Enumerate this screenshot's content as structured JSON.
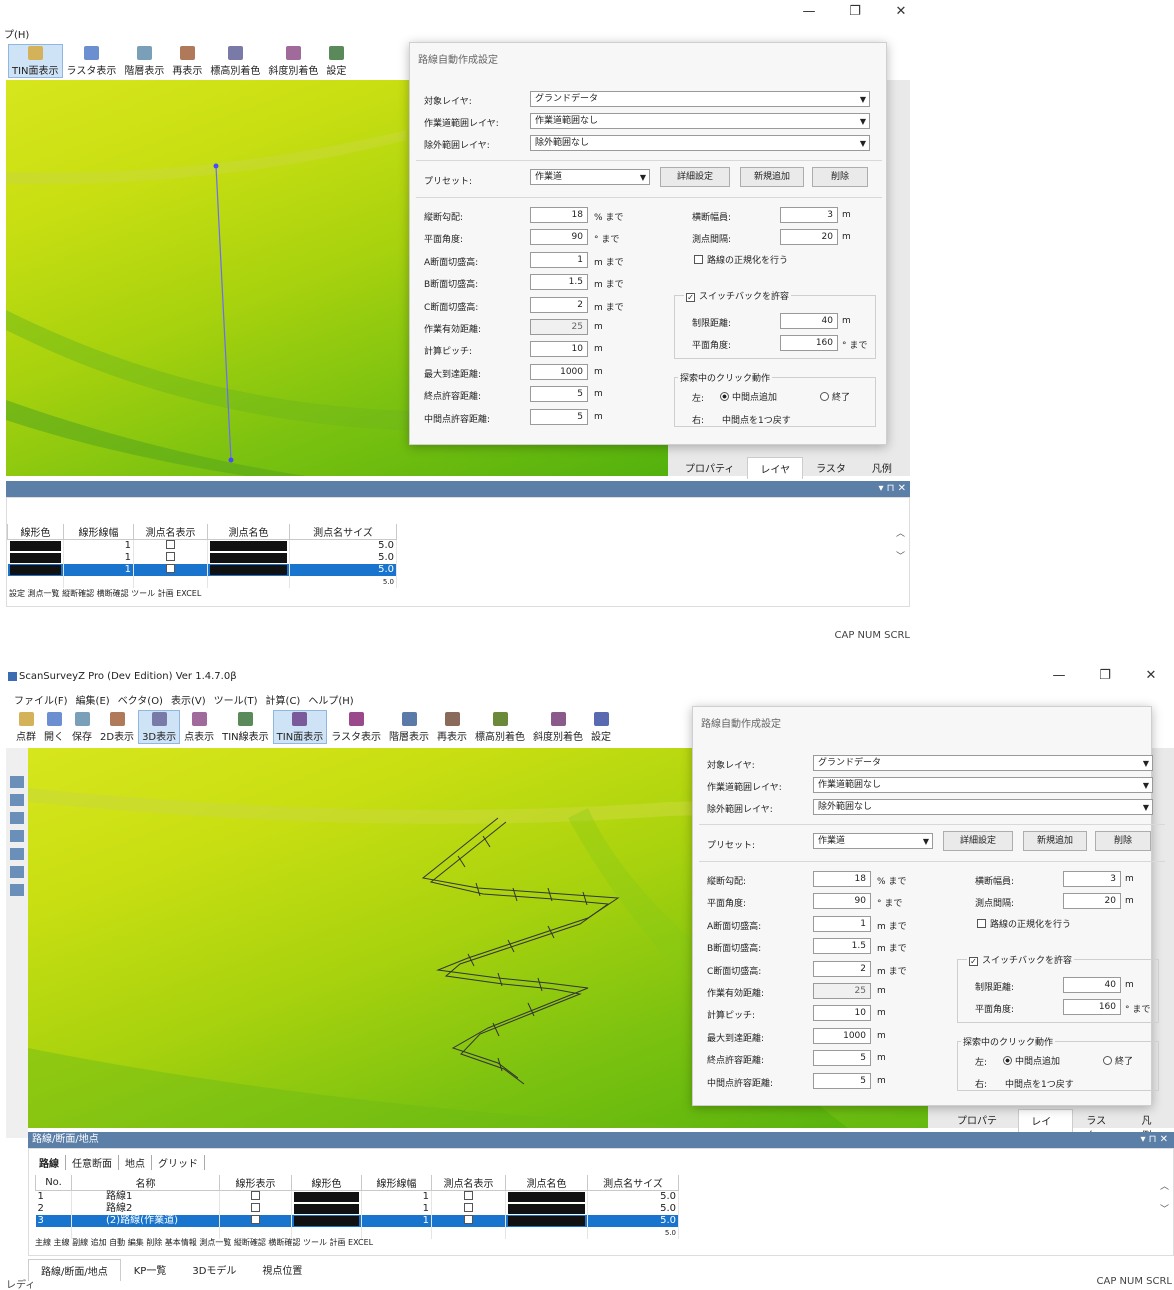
{
  "top": {
    "menu_help": "プ(H)",
    "toolbar": [
      {
        "label": "TIN面表示",
        "active": true
      },
      {
        "label": "ラスタ表示"
      },
      {
        "label": "階層表示"
      },
      {
        "label": "再表示"
      },
      {
        "label": "標高別着色"
      },
      {
        "label": "斜度別着色"
      },
      {
        "label": "設定"
      }
    ],
    "grid_headers": [
      "線形色",
      "線形線幅",
      "測点名表示",
      "測点名色",
      "測点名サイズ"
    ],
    "grid_rows": [
      {
        "width": "1",
        "size": "5.0",
        "selected": false
      },
      {
        "width": "1",
        "size": "5.0",
        "selected": false
      },
      {
        "width": "1",
        "size": "5.0",
        "selected": true
      }
    ],
    "grid_partial": "5.0",
    "bottom_tools": "設定  測点一覧  縦断確認  横断確認  ツール  計画  EXCEL",
    "dock_tabs": [
      "プロパティ",
      "レイヤ",
      "ラスタ",
      "凡例"
    ],
    "status": "CAP NUM SCRL"
  },
  "app": {
    "title": "ScanSurveyZ Pro  (Dev Edition)  Ver 1.4.7.0β",
    "menu": [
      "ファイル(F)",
      "編集(E)",
      "ベクタ(O)",
      "表示(V)",
      "ツール(T)",
      "計算(C)",
      "ヘルプ(H)"
    ],
    "toolbar": [
      {
        "label": "点群"
      },
      {
        "label": "開く"
      },
      {
        "label": "保存"
      },
      {
        "label": "2D表示"
      },
      {
        "label": "3D表示",
        "active": true
      },
      {
        "label": "点表示"
      },
      {
        "label": "TIN線表示"
      },
      {
        "label": "TIN面表示",
        "active": true
      },
      {
        "label": "ラスタ表示"
      },
      {
        "label": "階層表示"
      },
      {
        "label": "再表示"
      },
      {
        "label": "標高別着色"
      },
      {
        "label": "斜度別着色"
      },
      {
        "label": "設定"
      }
    ],
    "panel_title": "路線/断面/地点",
    "panel_tabs": [
      "路線",
      "任意断面",
      "地点",
      "グリッド"
    ],
    "grid_headers": [
      "No.",
      "名称",
      "線形表示",
      "線形色",
      "線形線幅",
      "測点名表示",
      "測点名色",
      "測点名サイズ"
    ],
    "grid_rows": [
      {
        "no": "1",
        "name": "路線1",
        "width": "1",
        "size": "5.0",
        "selected": false
      },
      {
        "no": "2",
        "name": "路線2",
        "width": "1",
        "size": "5.0",
        "selected": false
      },
      {
        "no": "3",
        "name": "(2)路線(作業道)",
        "width": "1",
        "size": "5.0",
        "selected": true
      }
    ],
    "grid_partial": "5.0",
    "bottom_tools": "主線   主線 副線   追加   自動   編集   削除   基本情報  測点一覧  縦断確認  横断確認   ツール   計画   EXCEL",
    "bottom_tabs": [
      "路線/断面/地点",
      "KP一覧",
      "3Dモデル",
      "視点位置"
    ],
    "dock_tabs": [
      "プロパティ",
      "レイヤ",
      "ラスタ",
      "凡例"
    ],
    "status_left": "レディ",
    "status_right": "CAP NUM SCRL"
  },
  "dialog": {
    "title": "路線自動作成設定",
    "target_layer_label": "対象レイヤ:",
    "target_layer": "グランドデータ",
    "road_range_label": "作業道範囲レイヤ:",
    "road_range": "作業道範囲なし",
    "exclude_label": "除外範囲レイヤ:",
    "exclude": "除外範囲なし",
    "preset_label": "プリセット:",
    "preset": "作業道",
    "detail_btn": "詳細設定",
    "add_btn": "新規追加",
    "delete_btn": "削除",
    "params": [
      {
        "label": "縦断勾配:",
        "value": "18",
        "unit": "% まで"
      },
      {
        "label": "平面角度:",
        "value": "90",
        "unit": "° まで"
      },
      {
        "label": "A断面切盛高:",
        "value": "1",
        "unit": "m まで"
      },
      {
        "label": "B断面切盛高:",
        "value": "1.5",
        "unit": "m まで"
      },
      {
        "label": "C断面切盛高:",
        "value": "2",
        "unit": "m まで"
      },
      {
        "label": "作業有効距離:",
        "value": "25",
        "unit": "m",
        "disabled": true
      },
      {
        "label": "計算ピッチ:",
        "value": "10",
        "unit": "m"
      },
      {
        "label": "最大到達距離:",
        "value": "1000",
        "unit": "m"
      },
      {
        "label": "終点許容距離:",
        "value": "5",
        "unit": "m"
      },
      {
        "label": "中間点許容距離:",
        "value": "5",
        "unit": "m"
      }
    ],
    "width_label": "横断幅員:",
    "width_value": "3",
    "width_unit": "m",
    "pitch_label": "測点間隔:",
    "pitch_value": "20",
    "pitch_unit": "m",
    "normalize_label": "路線の正規化を行う",
    "switchback_label": "スイッチバックを許容",
    "limit_label": "制限距離:",
    "limit_value": "40",
    "limit_unit": "m",
    "angle_label": "平面角度:",
    "angle_value": "160",
    "angle_unit": "° まで",
    "click_group": "探索中のクリック動作",
    "left_label": "左:",
    "left_opt1": "中間点追加",
    "left_opt2": "終了",
    "right_label": "右:",
    "right_text": "中間点を1つ戻す"
  }
}
